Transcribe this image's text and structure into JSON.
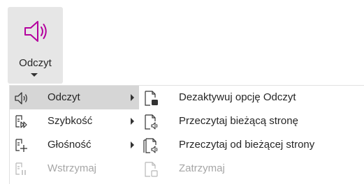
{
  "ribbon": {
    "button_label": "Odczyt",
    "button_icon": "speaker-icon"
  },
  "menu": {
    "items": [
      {
        "label": "Odczyt",
        "icon": "speaker-icon",
        "highlighted": true,
        "has_submenu": true,
        "disabled": false
      },
      {
        "label": "Szybkość",
        "icon": "speed-icon",
        "highlighted": false,
        "has_submenu": true,
        "disabled": false
      },
      {
        "label": "Głośność",
        "icon": "volume-icon",
        "highlighted": false,
        "has_submenu": true,
        "disabled": false
      },
      {
        "label": "Wstrzymaj",
        "icon": "pause-icon",
        "highlighted": false,
        "has_submenu": false,
        "disabled": true
      }
    ]
  },
  "submenu": {
    "items": [
      {
        "label": "Dezaktywuj opcję Odczyt",
        "icon": "document-stop-icon",
        "disabled": false
      },
      {
        "label": "Przeczytaj bieżącą stronę",
        "icon": "document-read-icon",
        "disabled": false
      },
      {
        "label": "Przeczytaj od bieżącej strony",
        "icon": "documents-read-icon",
        "disabled": false
      },
      {
        "label": "Zatrzymaj",
        "icon": "document-stop-disabled-icon",
        "disabled": true
      }
    ]
  },
  "colors": {
    "accent": "#b4009e",
    "highlight": "#d6d6d6",
    "ribbon_button_bg": "#e6e6e6",
    "disabled_text": "#a6a6a6"
  }
}
